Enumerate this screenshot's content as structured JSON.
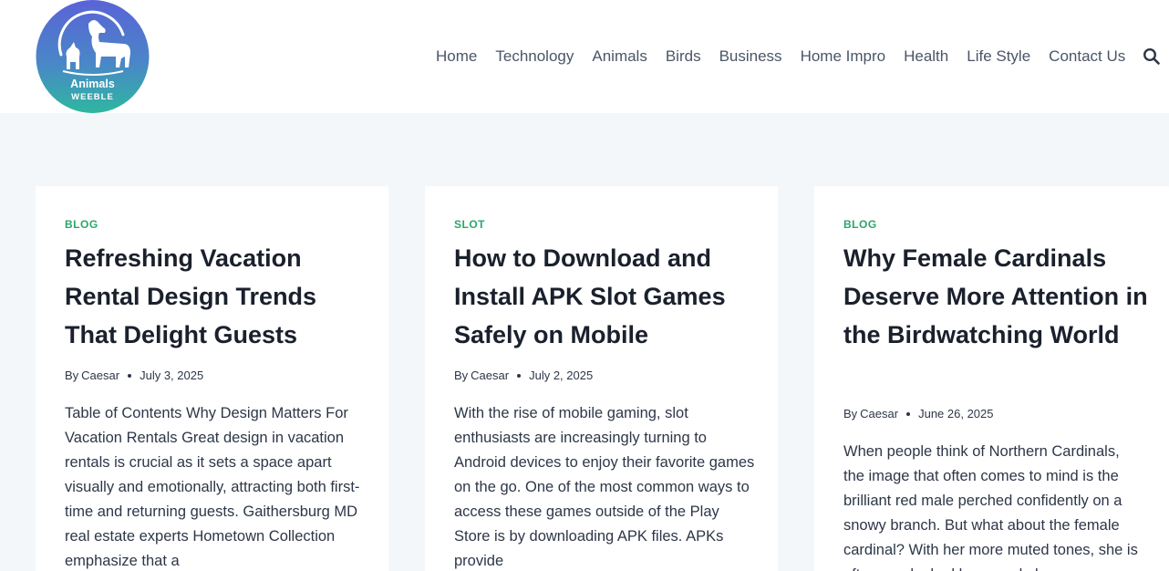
{
  "site": {
    "logo_text_top": "Animals",
    "logo_text_bottom": "WEEBLE"
  },
  "nav": {
    "items": [
      {
        "label": "Home"
      },
      {
        "label": "Technology"
      },
      {
        "label": "Animals"
      },
      {
        "label": "Birds"
      },
      {
        "label": "Business"
      },
      {
        "label": "Home Impro"
      },
      {
        "label": "Health"
      },
      {
        "label": "Life Style"
      },
      {
        "label": "Contact Us"
      }
    ],
    "search_icon": "search-icon"
  },
  "posts": [
    {
      "category": "BLOG",
      "title": "Refreshing Vacation Rental Design Trends That Delight Guests",
      "by": "By",
      "author": "Caesar",
      "date": "July 3, 2025",
      "excerpt": "Table of Contents Why Design Matters For Vacation Rentals Great design in vacation rentals is crucial as it sets a space apart visually and emotionally, attracting both first-time and returning guests. Gaithersburg MD real estate experts Hometown Collection emphasize that a"
    },
    {
      "category": "SLOT",
      "title": "How to Download and Install APK Slot Games Safely on Mobile",
      "by": "By",
      "author": "Caesar",
      "date": "July 2, 2025",
      "excerpt": "With the rise of mobile gaming, slot enthusiasts are increasingly turning to Android devices to enjoy their favorite games on the go. One of the most common ways to access these games outside of the Play Store is by downloading APK files. APKs provide"
    },
    {
      "category": "BLOG",
      "title": "Why Female Cardinals Deserve More Attention in the Birdwatching World",
      "by": "By",
      "author": "Caesar",
      "date": "June 26, 2025",
      "excerpt": "When people think of Northern Cardinals, the image that often comes to mind is the brilliant red male perched confidently on a snowy branch. But what about the female cardinal? With her more muted tones, she is often overlooked by casual observers"
    }
  ],
  "colors": {
    "accent": "#2aa76b",
    "page_bg": "#f4f7fa",
    "logo_gradient_top": "#5a63d6",
    "logo_gradient_bottom": "#2fb7a0"
  }
}
